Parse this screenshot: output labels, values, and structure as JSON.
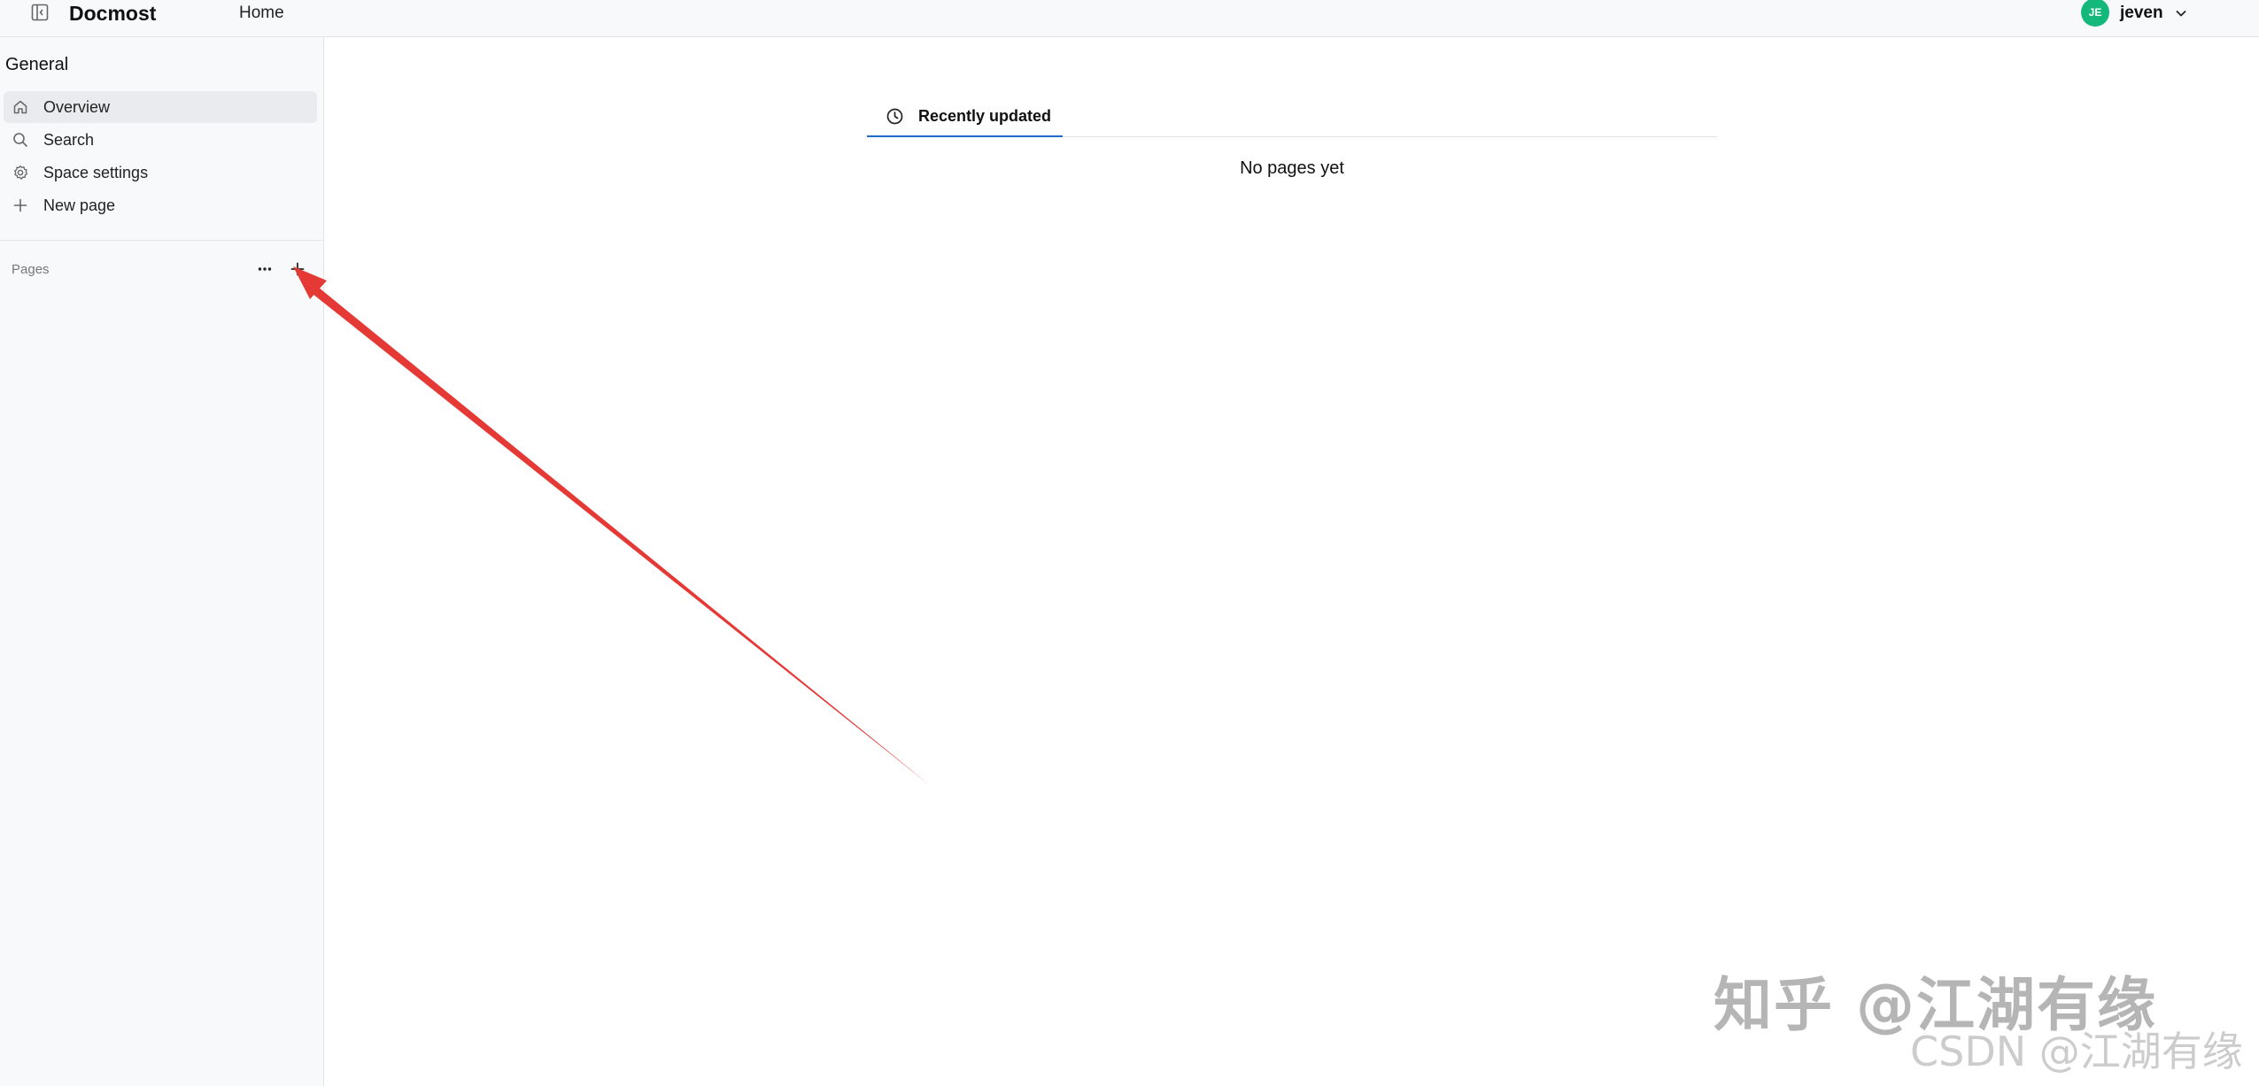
{
  "header": {
    "app_title": "Docmost",
    "home_link": "Home",
    "user": {
      "initials": "JE",
      "name": "jeven",
      "avatar_color": "#13b87a"
    }
  },
  "sidebar": {
    "space_title": "General",
    "items": [
      {
        "label": "Overview",
        "icon": "home-icon",
        "active": true
      },
      {
        "label": "Search",
        "icon": "search-icon"
      },
      {
        "label": "Space settings",
        "icon": "gear-icon"
      },
      {
        "label": "New page",
        "icon": "plus-icon"
      }
    ],
    "pages_label": "Pages"
  },
  "main": {
    "tabs": [
      {
        "label": "Recently updated",
        "icon": "clock-icon",
        "active": true
      }
    ],
    "empty_text": "No pages yet",
    "accent_color": "#1c6ec9"
  },
  "annotation": {
    "color": "#e53935",
    "points_to": "pages-add-button"
  },
  "watermarks": {
    "main": "知乎 @江湖有缘",
    "sub": "CSDN @江湖有缘"
  }
}
